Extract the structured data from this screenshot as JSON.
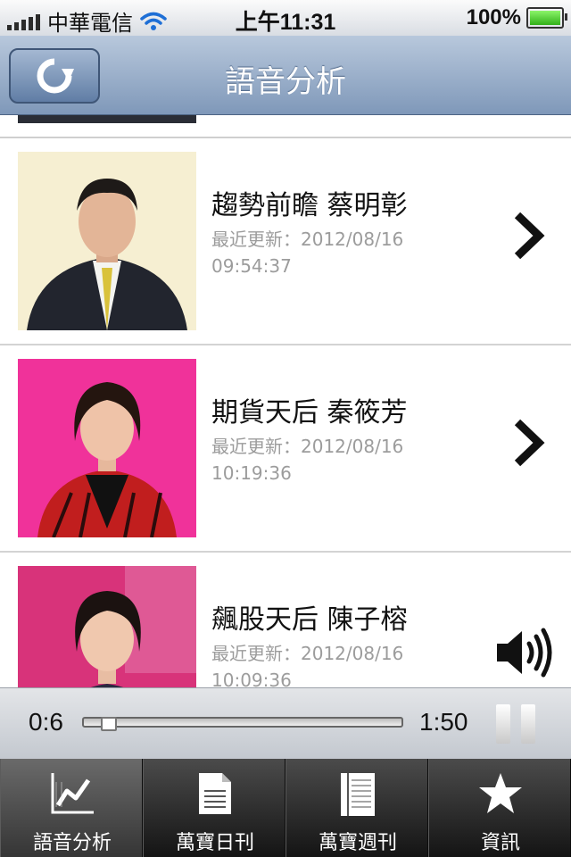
{
  "status_bar": {
    "carrier": "中華電信",
    "time": "上午11:31",
    "battery": "100%"
  },
  "nav": {
    "title": "語音分析",
    "refresh_icon": "refresh-icon"
  },
  "list": {
    "items": [
      {
        "name": "趨勢前瞻 蔡明彰",
        "updated_label": "最近更新：2012/08/16",
        "updated_time": "09:54:37",
        "accessory": "chevron-right-icon"
      },
      {
        "name": "期貨天后 秦筱芳",
        "updated_label": "最近更新：2012/08/16",
        "updated_time": "10:19:36",
        "accessory": "chevron-right-icon"
      },
      {
        "name": "飆股天后 陳子榕",
        "updated_label": "最近更新：2012/08/16",
        "updated_time": "10:09:36",
        "accessory": "speaker-icon"
      }
    ]
  },
  "player": {
    "current": "0:6",
    "total": "1:50",
    "progress": 0.055
  },
  "tabs": [
    {
      "label": "語音分析",
      "icon": "chart-icon",
      "selected": true
    },
    {
      "label": "萬寶日刊",
      "icon": "document-icon",
      "selected": false
    },
    {
      "label": "萬寶週刊",
      "icon": "notebook-icon",
      "selected": false
    },
    {
      "label": "資訊",
      "icon": "star-icon",
      "selected": false
    }
  ],
  "colors": {
    "nav_blue": "#8ea3c2",
    "photo_bg_1": "#f6efd2",
    "photo_bg_2": "#f0329a",
    "photo_bg_3": "#d8337a"
  }
}
